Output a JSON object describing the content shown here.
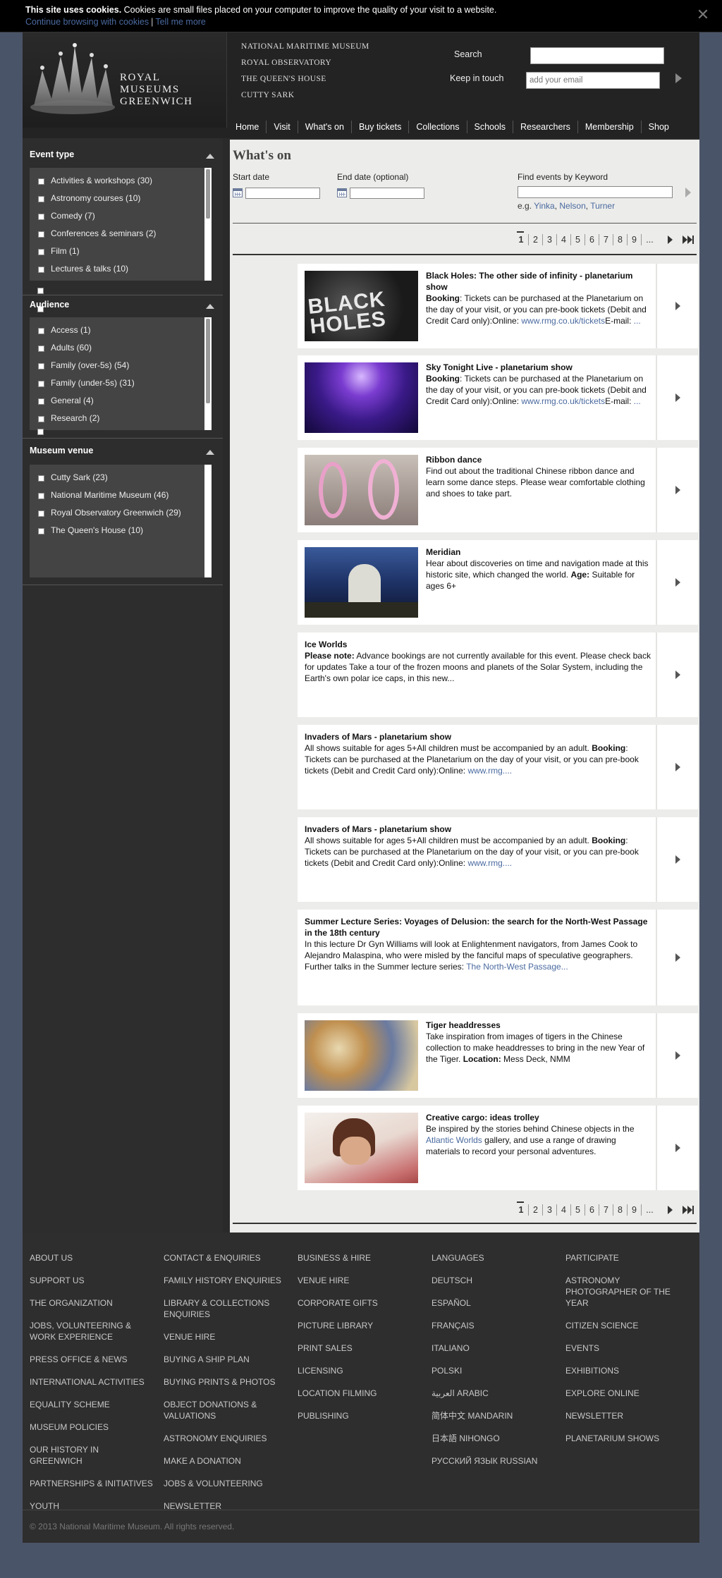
{
  "cookie": {
    "bold": "This site uses cookies.",
    "text": " Cookies are small files placed on your computer to improve the quality of your visit to a website.",
    "continue": "Continue browsing with cookies",
    "sep": "|",
    "more": "Tell me more",
    "close": "✕"
  },
  "header": {
    "logo": [
      "ROYAL",
      "MUSEUMS",
      "GREENWICH"
    ],
    "museums": [
      "NATIONAL MARITIME MUSEUM",
      "ROYAL OBSERVATORY",
      "THE QUEEN'S HOUSE",
      "CUTTY SARK"
    ],
    "search_label": "Search",
    "keep_label": "Keep in touch",
    "email_placeholder": "add your email",
    "nav": [
      "Home",
      "Visit",
      "What's on",
      "Buy tickets",
      "Collections",
      "Schools",
      "Researchers",
      "Membership",
      "Shop"
    ]
  },
  "filters": {
    "event_type": {
      "title": "Event type",
      "items": [
        "Activities & workshops (30)",
        "Astronomy courses (10)",
        "Comedy (7)",
        "Conferences & seminars (2)",
        "Film (1)",
        "Lectures & talks (10)"
      ]
    },
    "audience": {
      "title": "Audience",
      "items": [
        "Access (1)",
        "Adults (60)",
        "Family (over-5s) (54)",
        "Family (under-5s) (31)",
        "General (4)",
        "Research (2)"
      ]
    },
    "venue": {
      "title": "Museum venue",
      "items": [
        "Cutty Sark (23)",
        "National Maritime Museum (46)",
        "Royal Observatory Greenwich (29)",
        "The Queen's House (10)"
      ]
    }
  },
  "main": {
    "title": "What's on",
    "start_label": "Start date",
    "end_label": "End date (optional)",
    "keyword_label": "Find events by Keyword",
    "eg_prefix": "e.g. ",
    "eg_links": [
      "Yinka",
      "Nelson",
      "Turner"
    ],
    "eg_sep": ", ",
    "pages": [
      "1",
      "2",
      "3",
      "4",
      "5",
      "6",
      "7",
      "8",
      "9",
      "..."
    ]
  },
  "events": [
    {
      "title": "Black Holes: The other side of infinity - planetarium show",
      "desc_bold": "Booking",
      "desc": ": Tickets can be purchased at the Planetarium on the day of your visit, or you can pre-book tickets (Debit and Credit Card only):Online: ",
      "link": "www.rmg.co.uk/tickets",
      "desc2": "E-mail: ",
      "link2": "...",
      "thumb_text": "BLACK HOLES"
    },
    {
      "title": "Sky Tonight Live - planetarium show",
      "desc_bold": "Booking",
      "desc": ": Tickets can be purchased at the Planetarium on the day of your visit, or you can pre-book tickets (Debit and Credit Card only):Online: ",
      "link": "www.rmg.co.uk/tickets",
      "desc2": "E-mail: ",
      "link2": "..."
    },
    {
      "title": "Ribbon dance",
      "desc": "Find out about the traditional Chinese ribbon dance and learn some dance steps. Please wear comfortable clothing and shoes to take part."
    },
    {
      "title": "Meridian",
      "desc": "Hear about discoveries on time and navigation made at this historic site, which changed the world. ",
      "desc_bold": "Age:",
      "desc2": " Suitable for ages 6+"
    },
    {
      "title": "Ice Worlds",
      "desc_bold": "Please note:",
      "desc": " Advance bookings are not currently available for this event. Please check back for updates Take a tour of the frozen moons and planets of the Solar System, including the Earth's own polar ice caps, in this new..."
    },
    {
      "title": "Invaders of Mars - planetarium show",
      "desc": "All shows suitable for ages 5+All children must be accompanied by an adult. ",
      "desc_bold": "Booking",
      "desc2": ": Tickets can be purchased at the Planetarium on the day of your visit, or you can pre-book tickets (Debit and Credit Card only):Online: ",
      "link": "www.rmg...."
    },
    {
      "title": "Invaders of Mars - planetarium show",
      "desc": "All shows suitable for ages 5+All children must be accompanied by an adult. ",
      "desc_bold": "Booking",
      "desc2": ": Tickets can be purchased at the Planetarium on the day of your visit, or you can pre-book tickets (Debit and Credit Card only):Online: ",
      "link": "www.rmg...."
    },
    {
      "title": "Summer Lecture Series: Voyages of Delusion: the search for the North-West Passage in the 18th century",
      "desc": "In this lecture Dr Gyn Williams will look at Enlightenment navigators, from James Cook to Alejandro Malaspina, who were misled by the fanciful maps of speculative geographers. Further talks in the Summer lecture series: ",
      "link": "The North-West Passage..."
    },
    {
      "title": "Tiger headdresses",
      "desc": "Take inspiration from images of tigers in the Chinese collection to make headdresses to bring in the new Year of the Tiger. ",
      "desc_bold": "Location:",
      "desc2": " Mess Deck, NMM"
    },
    {
      "title": "Creative cargo: ideas trolley",
      "desc": "Be inspired by the stories behind Chinese objects in the ",
      "link": "Atlantic Worlds",
      "desc2": " gallery, and use a range of drawing materials to record your personal adventures."
    }
  ],
  "footer": {
    "col1": [
      "About us",
      "Support us",
      "The organization",
      "Jobs, volunteering & work experience",
      "Press office & news",
      "International activities",
      "Equality scheme",
      "Museum policies",
      "Our history in Greenwich",
      "Partnerships & initiatives",
      "Youth"
    ],
    "col2": [
      "Contact & enquiries",
      "Family history enquiries",
      "Library & collections enquiries",
      "Venue hire",
      "Buying a ship plan",
      "Buying prints & photos",
      "Object donations & valuations",
      "Astronomy enquiries",
      "Make a donation",
      "Jobs & volunteering",
      "Newsletter"
    ],
    "col3": [
      "Business & hire",
      "Venue hire",
      "Corporate gifts",
      "Picture library",
      "Print sales",
      "Licensing",
      "Location filming",
      "Publishing"
    ],
    "col4": [
      "Languages",
      "Deutsch",
      "Español",
      "Français",
      "Italiano",
      "Polski",
      "العربية Arabic",
      "简体中文 Mandarin",
      "日本語 Nihongo",
      "Русский язык Russian"
    ],
    "col5": [
      "Participate",
      "Astronomy Photographer of the Year",
      "Citizen science",
      "Events",
      "Exhibitions",
      "Explore online",
      "Newsletter",
      "Planetarium shows"
    ],
    "copyright": "© 2013 National Maritime Museum. All rights reserved."
  }
}
